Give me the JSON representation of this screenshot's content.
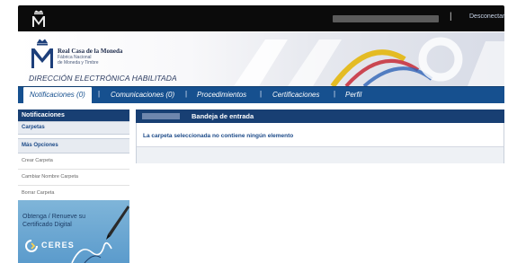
{
  "topbar": {
    "disconnect_label": "Desconectar",
    "separator": "|"
  },
  "banner": {
    "org_name": "Real Casa de la Moneda",
    "org_sub1": "Fábrica Nacional",
    "org_sub2": "de Moneda y Timbre",
    "section_title": "DIRECCIÓN ELECTRÓNICA HABILITADA"
  },
  "nav": {
    "tabs": [
      {
        "label": "Notificaciones (0)"
      },
      {
        "label": "Comunicaciones (0)"
      },
      {
        "label": "Procedimientos"
      },
      {
        "label": "Certificaciones"
      },
      {
        "label": "Perfil"
      }
    ],
    "separator": "|"
  },
  "sidebar": {
    "header": "Notificaciones",
    "folders_label": "Carpetas",
    "more_options_label": "Más Opciones",
    "items": [
      {
        "label": "Crear Carpeta"
      },
      {
        "label": "Cambiar Nombre Carpeta"
      },
      {
        "label": "Borrar Carpeta"
      }
    ],
    "promo": {
      "line1": "Obtenga / Renueve su",
      "line2": "Certificado Digital",
      "brand": "CERES"
    }
  },
  "main": {
    "title": "Bandeja de entrada",
    "empty_message": "La carpeta seleccionada no contiene ningún elemento"
  },
  "colors": {
    "nav_blue": "#16508f",
    "header_navy": "#183f73",
    "topbar_black": "#0b0b0b"
  }
}
